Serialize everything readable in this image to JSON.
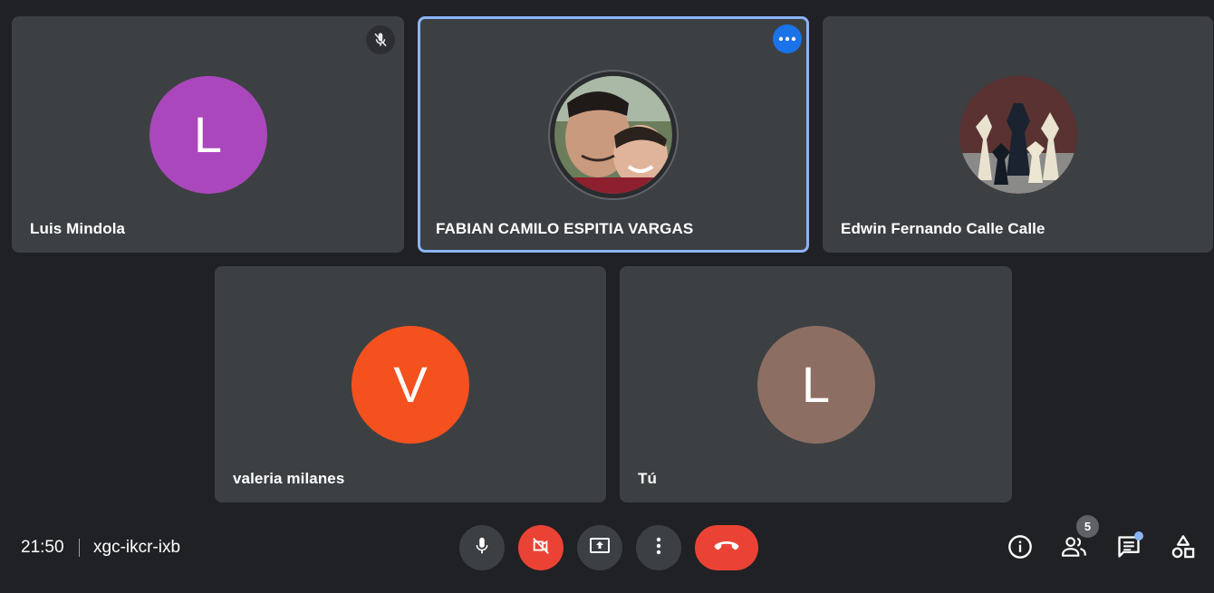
{
  "tiles": [
    {
      "name": "Luis Mindola",
      "initial": "L",
      "color": "#ab47bc",
      "muted": true
    },
    {
      "name": "FABIAN CAMILO ESPITIA VARGAS",
      "photo": "father-and-son-photo",
      "active": true
    },
    {
      "name": "Edwin Fernando Calle Calle",
      "photo": "chess-pieces-photo"
    },
    {
      "name": "valeria milanes",
      "initial": "V",
      "color": "#f4511e"
    },
    {
      "name": "Tú",
      "initial": "L",
      "color": "#8d6e63"
    }
  ],
  "bottom_bar": {
    "time": "21:50",
    "meeting_code": "xgc-ikcr-ixb",
    "people_count": "5",
    "controls": [
      "mic-icon",
      "camera-off-icon",
      "present-screen-icon",
      "more-options-icon",
      "end-call-icon"
    ],
    "right_icons": [
      "info-icon",
      "people-icon",
      "chat-icon",
      "activities-icon"
    ]
  },
  "colors": {
    "background": "#202124",
    "tile": "#3c4043",
    "accent": "#8ab4f8",
    "danger": "#ea4335",
    "badge_blue": "#1a73e8"
  }
}
